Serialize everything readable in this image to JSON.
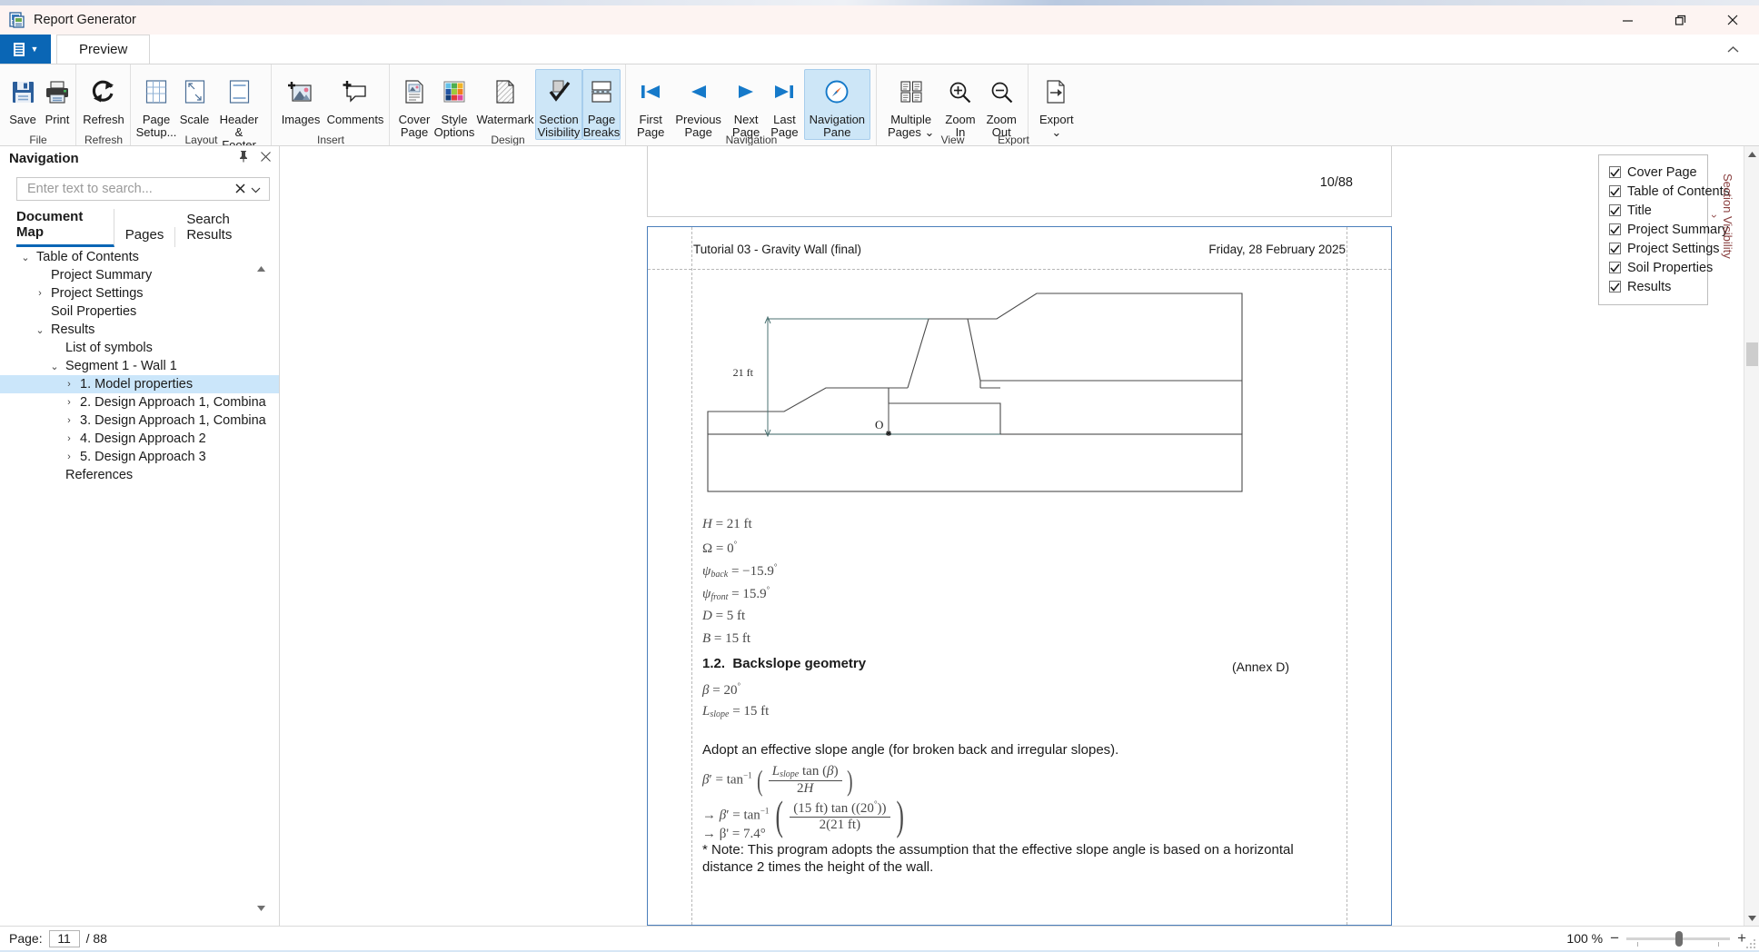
{
  "window": {
    "title": "Report Generator",
    "app_icon": "report-icon",
    "minimize": "—",
    "maximize": "❐",
    "close": "✕",
    "collapse_ribbon": "⌃"
  },
  "tabs": {
    "file_menu": "file-menu-icon",
    "items": [
      "Preview"
    ],
    "selected": "Preview"
  },
  "ribbon": {
    "groups": [
      {
        "label": "File",
        "buttons": [
          {
            "label": "Save",
            "icon": "save-icon"
          },
          {
            "label": "Print",
            "icon": "print-icon"
          }
        ]
      },
      {
        "label": "Refresh",
        "buttons": [
          {
            "label": "Refresh",
            "icon": "refresh-icon"
          }
        ]
      },
      {
        "label": "Layout",
        "buttons": [
          {
            "label": "Page\nSetup...",
            "icon": "page-setup-icon"
          },
          {
            "label": "Scale",
            "icon": "scale-icon"
          },
          {
            "label": "Header &\nFooter",
            "icon": "header-footer-icon"
          }
        ]
      },
      {
        "label": "Insert",
        "buttons": [
          {
            "label": "Images",
            "icon": "images-icon"
          },
          {
            "label": "Comments",
            "icon": "comments-icon"
          }
        ]
      },
      {
        "label": "Design",
        "buttons": [
          {
            "label": "Cover\nPage",
            "icon": "cover-page-icon"
          },
          {
            "label": "Style\nOptions",
            "icon": "style-options-icon"
          },
          {
            "label": "Watermark",
            "icon": "watermark-icon"
          },
          {
            "label": "Section\nVisibility",
            "icon": "section-visibility-icon",
            "active": true
          },
          {
            "label": "Page\nBreaks",
            "icon": "page-breaks-icon",
            "active": true
          }
        ]
      },
      {
        "label": "Navigation",
        "buttons": [
          {
            "label": "First\nPage",
            "icon": "first-page-icon"
          },
          {
            "label": "Previous\nPage",
            "icon": "previous-page-icon"
          },
          {
            "label": "Next\nPage",
            "icon": "next-page-icon"
          },
          {
            "label": "Last\nPage",
            "icon": "last-page-icon"
          },
          {
            "label": "Navigation\nPane",
            "icon": "navigation-pane-icon",
            "active": true
          }
        ]
      },
      {
        "label": "View",
        "buttons": [
          {
            "label": "Multiple\nPages ⌄",
            "icon": "multiple-pages-icon"
          },
          {
            "label": "Zoom\nIn",
            "icon": "zoom-in-icon"
          },
          {
            "label": "Zoom\nOut",
            "icon": "zoom-out-icon"
          }
        ]
      },
      {
        "label": "Export",
        "buttons": [
          {
            "label": "Export\n⌄",
            "icon": "export-icon"
          }
        ]
      }
    ]
  },
  "navigation": {
    "title": "Navigation",
    "pin_icon": "pin-icon",
    "close_icon": "close-icon",
    "search": {
      "value": "",
      "placeholder": "Enter text to search...",
      "clear_icon": "clear-icon",
      "dropdown_icon": "chevron-down-icon"
    },
    "tabs": [
      "Document Map",
      "Pages",
      "Search Results"
    ],
    "selected_tab": "Document Map",
    "tree": [
      {
        "label": "Table of Contents",
        "depth": 0,
        "state": "expanded",
        "selected": false
      },
      {
        "label": "Project Summary",
        "depth": 1,
        "state": "leaf",
        "selected": false
      },
      {
        "label": "Project Settings",
        "depth": 1,
        "state": "collapsed",
        "selected": false
      },
      {
        "label": "Soil Properties",
        "depth": 1,
        "state": "leaf",
        "selected": false
      },
      {
        "label": "Results",
        "depth": 1,
        "state": "expanded",
        "selected": false
      },
      {
        "label": "List of symbols",
        "depth": 2,
        "state": "leaf",
        "selected": false
      },
      {
        "label": "Segment 1 - Wall 1",
        "depth": 2,
        "state": "expanded",
        "selected": false
      },
      {
        "label": "1. Model properties",
        "depth": 3,
        "state": "collapsed",
        "selected": true
      },
      {
        "label": "2. Design Approach 1, Combina",
        "depth": 3,
        "state": "collapsed",
        "selected": false
      },
      {
        "label": "3. Design Approach 1, Combina",
        "depth": 3,
        "state": "collapsed",
        "selected": false
      },
      {
        "label": "4. Design Approach 2",
        "depth": 3,
        "state": "collapsed",
        "selected": false
      },
      {
        "label": "5. Design Approach 3",
        "depth": 3,
        "state": "collapsed",
        "selected": false
      },
      {
        "label": "References",
        "depth": 2,
        "state": "leaf",
        "selected": false
      }
    ]
  },
  "document": {
    "previous_page_number": "10/88",
    "header_left": "Tutorial 03 - Gravity Wall (final)",
    "header_right": "Friday, 28 February 2025",
    "figure": {
      "dimension_label": "21 ft",
      "origin_label": "O"
    },
    "annex": "(Annex D)",
    "section_1_1_equations": [
      "H = 21 ft",
      "Ω = 0°",
      "ψback = −15.9°",
      "ψfront = 15.9°",
      "D = 5 ft",
      "B = 15 ft"
    ],
    "section_1_2": {
      "number": "1.2.",
      "title": "Backslope geometry",
      "beta": "β = 20°",
      "lslope": "Lslope = 15 ft",
      "adopt_text": "Adopt an effective slope angle (for broken back and irregular slopes).",
      "eq_lhs": "β' = tan⁻¹",
      "eq_num": "Lslope tan (β)",
      "eq_den": "2H",
      "eq2_lhs": "→ β' = tan⁻¹",
      "eq2_num": "(15 ft) tan ((20°))",
      "eq2_den": "2(21 ft)",
      "eq3": "→ β' = 7.4°",
      "note": "* Note: This program adopts the assumption that the effective slope angle is based on a horizontal distance 2 times the height of the wall."
    }
  },
  "section_visibility": {
    "tab_label": "Section Visibility",
    "tab_chevron": "›",
    "items": [
      {
        "label": "Cover Page",
        "checked": true
      },
      {
        "label": "Table of Contents",
        "checked": true
      },
      {
        "label": "Title",
        "checked": true
      },
      {
        "label": "Project Summary",
        "checked": true
      },
      {
        "label": "Project Settings",
        "checked": true
      },
      {
        "label": "Soil Properties",
        "checked": true
      },
      {
        "label": "Results",
        "checked": true
      }
    ]
  },
  "status": {
    "page_label": "Page:",
    "page_value": "11",
    "page_total": "/ 88",
    "zoom_level": "100 %",
    "zoom_out": "−",
    "zoom_in": "+"
  },
  "colors": {
    "accent": "#0a66b5",
    "ribbon_active": "#cde6f7",
    "tree_selected": "#cbe6fa",
    "page_border": "#4a7ebb",
    "titlebar": "#fdf4f2"
  }
}
